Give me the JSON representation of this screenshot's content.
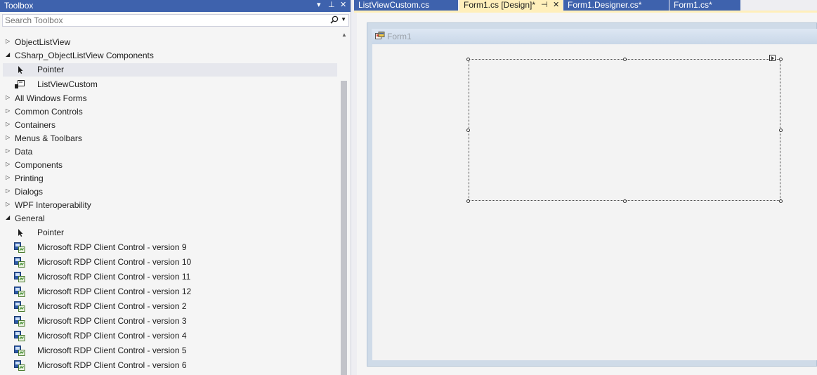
{
  "toolbox": {
    "title": "Toolbox",
    "controls": {
      "dropdown": "▾",
      "pin": "⊥",
      "close": "✕"
    },
    "search_placeholder": "Search Toolbox",
    "items": [
      {
        "kind": "cat",
        "expanded": false,
        "label": "ObjectListView"
      },
      {
        "kind": "cat",
        "expanded": true,
        "label": "CSharp_ObjectListView Components"
      },
      {
        "kind": "item",
        "icon": "pointer",
        "label": "Pointer",
        "selected": true
      },
      {
        "kind": "item",
        "icon": "component",
        "label": "ListViewCustom"
      },
      {
        "kind": "cat",
        "expanded": false,
        "label": "All Windows Forms"
      },
      {
        "kind": "cat",
        "expanded": false,
        "label": "Common Controls"
      },
      {
        "kind": "cat",
        "expanded": false,
        "label": "Containers"
      },
      {
        "kind": "cat",
        "expanded": false,
        "label": "Menus & Toolbars"
      },
      {
        "kind": "cat",
        "expanded": false,
        "label": "Data"
      },
      {
        "kind": "cat",
        "expanded": false,
        "label": "Components"
      },
      {
        "kind": "cat",
        "expanded": false,
        "label": "Printing"
      },
      {
        "kind": "cat",
        "expanded": false,
        "label": "Dialogs"
      },
      {
        "kind": "cat",
        "expanded": false,
        "label": "WPF Interoperability"
      },
      {
        "kind": "cat",
        "expanded": true,
        "label": "General"
      },
      {
        "kind": "item",
        "icon": "pointer",
        "label": "Pointer"
      },
      {
        "kind": "item",
        "icon": "activex",
        "label": "Microsoft RDP Client Control - version 9"
      },
      {
        "kind": "item",
        "icon": "activex",
        "label": "Microsoft RDP Client Control - version 10"
      },
      {
        "kind": "item",
        "icon": "activex",
        "label": "Microsoft RDP Client Control - version 11"
      },
      {
        "kind": "item",
        "icon": "activex",
        "label": "Microsoft RDP Client Control - version 12"
      },
      {
        "kind": "item",
        "icon": "activex",
        "label": "Microsoft RDP Client Control - version 2"
      },
      {
        "kind": "item",
        "icon": "activex",
        "label": "Microsoft RDP Client Control - version 3"
      },
      {
        "kind": "item",
        "icon": "activex",
        "label": "Microsoft RDP Client Control - version 4"
      },
      {
        "kind": "item",
        "icon": "activex",
        "label": "Microsoft RDP Client Control - version 5"
      },
      {
        "kind": "item",
        "icon": "activex",
        "label": "Microsoft RDP Client Control - version 6"
      }
    ]
  },
  "tabs": [
    {
      "label": "ListViewCustom.cs",
      "active": false
    },
    {
      "label": "Form1.cs [Design]*",
      "active": true,
      "pin": "⊣",
      "close": "✕"
    },
    {
      "label": "Form1.Designer.cs*",
      "active": false
    },
    {
      "label": "Form1.cs*",
      "active": false
    }
  ],
  "designer": {
    "form_title": "Form1"
  },
  "colors": {
    "title_bar": "#3e62ad",
    "active_tab": "#ffefbb",
    "selection": "#e6e7ed"
  }
}
